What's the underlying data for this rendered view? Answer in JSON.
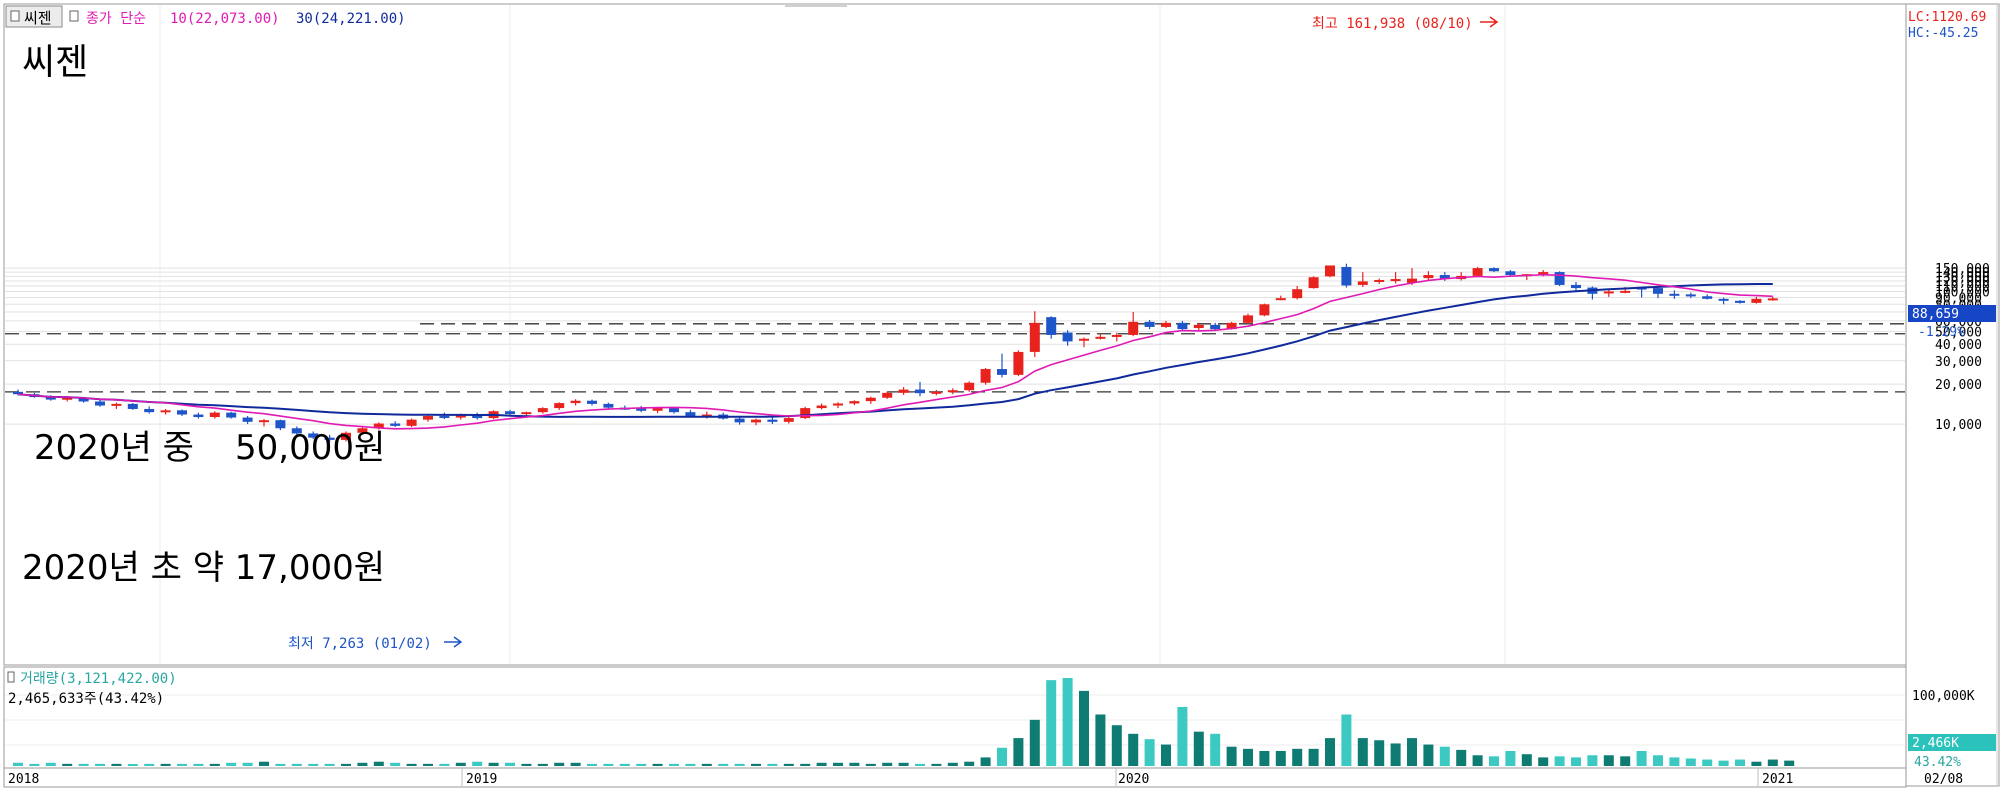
{
  "header": {
    "stock_tab": "씨젠",
    "ma_label_prefix": "종가 단순",
    "ma10_label": "10(22,073.00)",
    "ma30_label": "30(24,221.00)",
    "lc_label": "LC:1120.69",
    "hc_label": "HC:-45.25"
  },
  "annotations": {
    "stock_name": "씨젠",
    "mid2020_text": "2020년 중",
    "mid2020_price": "50,000원",
    "early2020_text": "2020년 초 약 17,000원",
    "high_label": "최고 161,938 (08/10)",
    "low_label": "최저 7,263 (01/02)"
  },
  "price_panel": {
    "current_price_badge": "88,659",
    "change_pct": "-1.29%",
    "yaxis_ticks": [
      "150,000",
      "140,000",
      "130,000",
      "120,000",
      "110,000",
      "100,000",
      "90,000",
      "80,000",
      "70,000",
      "60,000",
      "50,000",
      "40,000",
      "30,000",
      "20,000",
      "10,000"
    ]
  },
  "volume_panel": {
    "title": "거래량(3,121,422.00)",
    "subtitle": "2,465,633주(43.42%)",
    "yaxis_top": "100,000K",
    "badge_value": "2,466K",
    "badge_pct": "43.42%"
  },
  "xaxis_labels": [
    "2018",
    "2019",
    "2020",
    "2021",
    "02/08"
  ],
  "colors": {
    "up": "#e8231e",
    "down": "#1e55c8",
    "ma10": "#e01ab4",
    "ma30": "#102a9c",
    "volume_up": "#0e7c73",
    "volume_down": "#3cc9c2",
    "badge": "#1646c6"
  },
  "chart_data": {
    "type": "candlestick",
    "ylim": [
      0,
      165000
    ],
    "gridlines": true,
    "reference_lines": [
      57000,
      48000,
      17500
    ],
    "x_start": "2017-12",
    "x_end": "2021-02",
    "high": {
      "value": 161938,
      "date": "08/10"
    },
    "low": {
      "value": 7263,
      "date": "01/02"
    },
    "ohlc": [
      {
        "o": 17500,
        "h": 18200,
        "l": 16500,
        "c": 16800
      },
      {
        "o": 16800,
        "h": 17200,
        "l": 15800,
        "c": 16000
      },
      {
        "o": 16000,
        "h": 16500,
        "l": 15000,
        "c": 15300
      },
      {
        "o": 15300,
        "h": 16200,
        "l": 14800,
        "c": 15800
      },
      {
        "o": 15800,
        "h": 16000,
        "l": 14500,
        "c": 14800
      },
      {
        "o": 14800,
        "h": 15200,
        "l": 13500,
        "c": 13800
      },
      {
        "o": 13800,
        "h": 14500,
        "l": 13000,
        "c": 14200
      },
      {
        "o": 14200,
        "h": 14400,
        "l": 12800,
        "c": 13000
      },
      {
        "o": 13000,
        "h": 13600,
        "l": 12000,
        "c": 12300
      },
      {
        "o": 12300,
        "h": 13000,
        "l": 11800,
        "c": 12700
      },
      {
        "o": 12700,
        "h": 12900,
        "l": 11500,
        "c": 11800
      },
      {
        "o": 11800,
        "h": 12200,
        "l": 11000,
        "c": 11300
      },
      {
        "o": 11300,
        "h": 12500,
        "l": 11000,
        "c": 12200
      },
      {
        "o": 12200,
        "h": 12400,
        "l": 11000,
        "c": 11200
      },
      {
        "o": 11200,
        "h": 11500,
        "l": 10000,
        "c": 10400
      },
      {
        "o": 10400,
        "h": 10900,
        "l": 9600,
        "c": 10700
      },
      {
        "o": 10700,
        "h": 10800,
        "l": 9000,
        "c": 9300
      },
      {
        "o": 9300,
        "h": 9600,
        "l": 8200,
        "c": 8500
      },
      {
        "o": 8500,
        "h": 8800,
        "l": 7700,
        "c": 7900
      },
      {
        "o": 7900,
        "h": 8300,
        "l": 7263,
        "c": 7600
      },
      {
        "o": 7600,
        "h": 8800,
        "l": 7400,
        "c": 8600
      },
      {
        "o": 8600,
        "h": 9500,
        "l": 8300,
        "c": 9300
      },
      {
        "o": 9300,
        "h": 10300,
        "l": 9100,
        "c": 10100
      },
      {
        "o": 10100,
        "h": 10500,
        "l": 9500,
        "c": 9700
      },
      {
        "o": 9700,
        "h": 11000,
        "l": 9500,
        "c": 10800
      },
      {
        "o": 10800,
        "h": 11800,
        "l": 10400,
        "c": 11500
      },
      {
        "o": 11500,
        "h": 12200,
        "l": 10900,
        "c": 11200
      },
      {
        "o": 11200,
        "h": 12000,
        "l": 10800,
        "c": 11700
      },
      {
        "o": 11700,
        "h": 12200,
        "l": 10800,
        "c": 11100
      },
      {
        "o": 11100,
        "h": 12700,
        "l": 10900,
        "c": 12500
      },
      {
        "o": 12500,
        "h": 12800,
        "l": 11600,
        "c": 11900
      },
      {
        "o": 11900,
        "h": 12400,
        "l": 11500,
        "c": 12300
      },
      {
        "o": 12300,
        "h": 13400,
        "l": 12000,
        "c": 13200
      },
      {
        "o": 13200,
        "h": 14600,
        "l": 12800,
        "c": 14400
      },
      {
        "o": 14400,
        "h": 15400,
        "l": 13800,
        "c": 15000
      },
      {
        "o": 15000,
        "h": 15300,
        "l": 13800,
        "c": 14200
      },
      {
        "o": 14200,
        "h": 14500,
        "l": 13000,
        "c": 13300
      },
      {
        "o": 13300,
        "h": 13800,
        "l": 12800,
        "c": 13100
      },
      {
        "o": 13100,
        "h": 13700,
        "l": 12300,
        "c": 12600
      },
      {
        "o": 12600,
        "h": 13400,
        "l": 12100,
        "c": 13200
      },
      {
        "o": 13200,
        "h": 13500,
        "l": 12000,
        "c": 12300
      },
      {
        "o": 12300,
        "h": 12800,
        "l": 11200,
        "c": 11500
      },
      {
        "o": 11500,
        "h": 12400,
        "l": 11000,
        "c": 11800
      },
      {
        "o": 11800,
        "h": 12200,
        "l": 10800,
        "c": 11000
      },
      {
        "o": 11000,
        "h": 11300,
        "l": 9900,
        "c": 10300
      },
      {
        "o": 10300,
        "h": 11000,
        "l": 9800,
        "c": 10800
      },
      {
        "o": 10800,
        "h": 11200,
        "l": 10000,
        "c": 10400
      },
      {
        "o": 10400,
        "h": 11400,
        "l": 10100,
        "c": 11100
      },
      {
        "o": 11100,
        "h": 13500,
        "l": 10900,
        "c": 13200
      },
      {
        "o": 13200,
        "h": 14300,
        "l": 12900,
        "c": 13800
      },
      {
        "o": 13800,
        "h": 14600,
        "l": 13200,
        "c": 14300
      },
      {
        "o": 14300,
        "h": 15100,
        "l": 13900,
        "c": 14900
      },
      {
        "o": 14900,
        "h": 16100,
        "l": 14200,
        "c": 15800
      },
      {
        "o": 15800,
        "h": 17600,
        "l": 15500,
        "c": 17200
      },
      {
        "o": 17200,
        "h": 19000,
        "l": 16600,
        "c": 18200
      },
      {
        "o": 18200,
        "h": 20800,
        "l": 16200,
        "c": 17100
      },
      {
        "o": 17100,
        "h": 18100,
        "l": 16500,
        "c": 17500
      },
      {
        "o": 17500,
        "h": 18600,
        "l": 16800,
        "c": 18000
      },
      {
        "o": 18000,
        "h": 21000,
        "l": 17500,
        "c": 20500
      },
      {
        "o": 20500,
        "h": 26500,
        "l": 19800,
        "c": 26000
      },
      {
        "o": 26000,
        "h": 34000,
        "l": 22500,
        "c": 23500
      },
      {
        "o": 23500,
        "h": 36000,
        "l": 23000,
        "c": 35000
      },
      {
        "o": 35000,
        "h": 71000,
        "l": 32000,
        "c": 58000
      },
      {
        "o": 64000,
        "h": 65000,
        "l": 44000,
        "c": 47000
      },
      {
        "o": 49000,
        "h": 51000,
        "l": 39000,
        "c": 42000
      },
      {
        "o": 43000,
        "h": 45000,
        "l": 38000,
        "c": 44000
      },
      {
        "o": 44000,
        "h": 48000,
        "l": 43500,
        "c": 45500
      },
      {
        "o": 46000,
        "h": 49000,
        "l": 42000,
        "c": 47000
      },
      {
        "o": 47000,
        "h": 70000,
        "l": 46000,
        "c": 59000
      },
      {
        "o": 59000,
        "h": 61000,
        "l": 52000,
        "c": 54000
      },
      {
        "o": 54000,
        "h": 60000,
        "l": 53000,
        "c": 58000
      },
      {
        "o": 58000,
        "h": 60000,
        "l": 51000,
        "c": 52000
      },
      {
        "o": 53000,
        "h": 58000,
        "l": 51000,
        "c": 56000
      },
      {
        "o": 56000,
        "h": 58000,
        "l": 51000,
        "c": 52000
      },
      {
        "o": 52000,
        "h": 59000,
        "l": 51500,
        "c": 58000
      },
      {
        "o": 58000,
        "h": 68000,
        "l": 57000,
        "c": 66000
      },
      {
        "o": 66000,
        "h": 81000,
        "l": 65000,
        "c": 80000
      },
      {
        "o": 88000,
        "h": 93000,
        "l": 86000,
        "c": 89000
      },
      {
        "o": 89000,
        "h": 110000,
        "l": 87000,
        "c": 104000
      },
      {
        "o": 106000,
        "h": 130000,
        "l": 105000,
        "c": 128000
      },
      {
        "o": 130000,
        "h": 157000,
        "l": 128000,
        "c": 157000
      },
      {
        "o": 153000,
        "h": 161938,
        "l": 107000,
        "c": 111000
      },
      {
        "o": 112000,
        "h": 140000,
        "l": 108000,
        "c": 119000
      },
      {
        "o": 119000,
        "h": 125000,
        "l": 114000,
        "c": 122000
      },
      {
        "o": 122000,
        "h": 140000,
        "l": 115000,
        "c": 124000
      },
      {
        "o": 116000,
        "h": 150000,
        "l": 112000,
        "c": 125000
      },
      {
        "o": 126000,
        "h": 142000,
        "l": 120000,
        "c": 133000
      },
      {
        "o": 133000,
        "h": 140000,
        "l": 120000,
        "c": 124000
      },
      {
        "o": 124000,
        "h": 140000,
        "l": 121000,
        "c": 131000
      },
      {
        "o": 131000,
        "h": 153000,
        "l": 130000,
        "c": 150000
      },
      {
        "o": 150000,
        "h": 152000,
        "l": 140000,
        "c": 142000
      },
      {
        "o": 142000,
        "h": 145000,
        "l": 132000,
        "c": 133000
      },
      {
        "o": 133000,
        "h": 135000,
        "l": 122000,
        "c": 135000
      },
      {
        "o": 135000,
        "h": 145000,
        "l": 130000,
        "c": 140000
      },
      {
        "o": 140000,
        "h": 142000,
        "l": 110000,
        "c": 112000
      },
      {
        "o": 112000,
        "h": 118000,
        "l": 100000,
        "c": 106000
      },
      {
        "o": 107000,
        "h": 109000,
        "l": 87000,
        "c": 96000
      },
      {
        "o": 97000,
        "h": 104000,
        "l": 91000,
        "c": 100000
      },
      {
        "o": 100000,
        "h": 108000,
        "l": 97000,
        "c": 101000
      },
      {
        "o": 107000,
        "h": 108000,
        "l": 90000,
        "c": 104000
      },
      {
        "o": 106000,
        "h": 107000,
        "l": 89000,
        "c": 96000
      },
      {
        "o": 96000,
        "h": 102000,
        "l": 88000,
        "c": 95000
      },
      {
        "o": 95000,
        "h": 98000,
        "l": 89000,
        "c": 92000
      },
      {
        "o": 92000,
        "h": 95000,
        "l": 87000,
        "c": 88000
      },
      {
        "o": 88000,
        "h": 90000,
        "l": 80000,
        "c": 85000
      },
      {
        "o": 85000,
        "h": 86000,
        "l": 81000,
        "c": 82000
      },
      {
        "o": 82000,
        "h": 91000,
        "l": 81000,
        "c": 88000
      },
      {
        "o": 88000,
        "h": 91000,
        "l": 85000,
        "c": 88659
      }
    ],
    "volume_k": [
      3,
      2,
      3,
      2,
      2,
      2,
      2,
      1,
      2,
      2,
      2,
      2,
      2,
      3,
      3,
      4,
      2,
      2,
      2,
      2,
      2,
      3,
      4,
      3,
      2,
      2,
      2,
      3,
      4,
      3,
      3,
      2,
      2,
      3,
      3,
      2,
      2,
      2,
      2,
      2,
      2,
      2,
      2,
      2,
      2,
      2,
      2,
      2,
      2,
      3,
      3,
      3,
      2,
      3,
      3,
      2,
      2,
      3,
      4,
      8,
      17,
      26,
      43,
      80,
      82,
      70,
      48,
      38,
      30,
      25,
      20,
      55,
      32,
      30,
      18,
      16,
      14,
      14,
      16,
      16,
      26,
      48,
      26,
      24,
      21,
      26,
      20,
      18,
      15,
      10,
      9,
      14,
      11,
      8,
      9,
      8,
      10,
      10,
      9,
      14,
      10,
      8,
      7,
      6,
      5,
      6,
      4,
      6,
      5
    ]
  }
}
